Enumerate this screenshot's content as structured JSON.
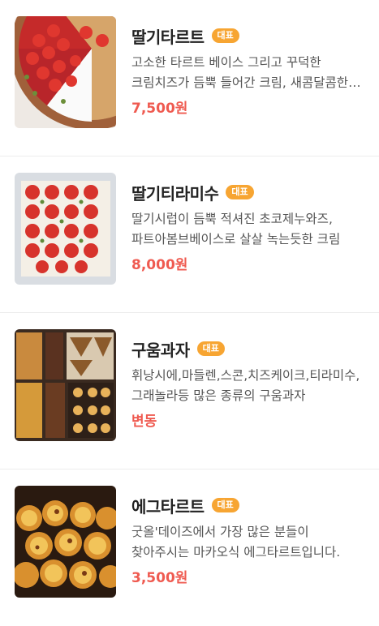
{
  "badge_label": "대표",
  "items": [
    {
      "name": "딸기타르트",
      "description": "고소한 타르트 베이스 그리고 꾸덕한 크림치즈가 듬뿍 들어간 크림, 새콤달콤한 딸기",
      "price": "7,500원"
    },
    {
      "name": "딸기티라미수",
      "description": "딸기시럽이 듬뿍 적셔진 초코제누와즈, 파트아봄브베이스로 살살 녹는듯한 크림",
      "price": "8,000원"
    },
    {
      "name": "구움과자",
      "description": "휘낭시에,마들렌,스콘,치즈케이크,티라미수,그래놀라등 많은 종류의 구움과자",
      "price": "변동"
    },
    {
      "name": "에그타르트",
      "description": "굿올'데이즈에서 가장 많은 분들이 찾아주시는 마카오식 에그타르트입니다.",
      "price": "3,500원"
    }
  ],
  "colors": {
    "badge": "#f7a532",
    "price": "#ef5a50"
  }
}
